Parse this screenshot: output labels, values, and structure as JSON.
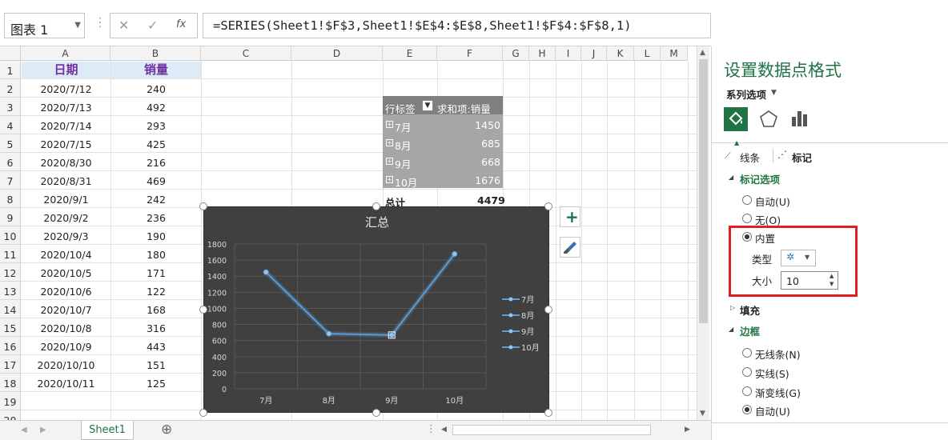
{
  "name_box": {
    "value": "图表 1"
  },
  "formula_bar": {
    "cancel_icon": "✕",
    "enter_icon": "✓",
    "fx_icon": "fx",
    "formula": "=SERIES(Sheet1!$F$3,Sheet1!$E$4:$E$8,Sheet1!$F$4:$F$8,1)"
  },
  "grid": {
    "columns": [
      "A",
      "B",
      "C",
      "D",
      "E",
      "F",
      "G",
      "H",
      "I",
      "J",
      "K",
      "L",
      "M"
    ],
    "rows": [
      "1",
      "2",
      "3",
      "4",
      "5",
      "6",
      "7",
      "8",
      "9",
      "10",
      "11",
      "12",
      "13",
      "14",
      "15",
      "16",
      "17",
      "18",
      "19",
      "20"
    ],
    "header_date": "日期",
    "header_sales": "销量",
    "dates": [
      "2020/7/12",
      "2020/7/13",
      "2020/7/14",
      "2020/7/15",
      "2020/8/30",
      "2020/8/31",
      "2020/9/1",
      "2020/9/2",
      "2020/9/3",
      "2020/10/4",
      "2020/10/5",
      "2020/10/6",
      "2020/10/7",
      "2020/10/8",
      "2020/10/9",
      "2020/10/10",
      "2020/10/11"
    ],
    "sales": [
      "240",
      "492",
      "293",
      "425",
      "216",
      "469",
      "242",
      "236",
      "190",
      "180",
      "171",
      "122",
      "168",
      "316",
      "443",
      "151",
      "125"
    ]
  },
  "pivot": {
    "row_label": "行标签",
    "sum_label": "求和项:销量",
    "rows": [
      {
        "label": "7月",
        "value": "1450"
      },
      {
        "label": "8月",
        "value": "685"
      },
      {
        "label": "9月",
        "value": "668"
      },
      {
        "label": "10月",
        "value": "1676"
      }
    ],
    "total_label": "总计",
    "total_value": "4479"
  },
  "chart_data": {
    "type": "line",
    "title": "汇总",
    "categories": [
      "7月",
      "8月",
      "9月",
      "10月"
    ],
    "series": [
      {
        "values": [
          1450,
          685,
          668,
          1676
        ]
      }
    ],
    "ylim": [
      0,
      1800
    ],
    "yticks": [
      "0",
      "200",
      "400",
      "600",
      "800",
      "1000",
      "1200",
      "1400",
      "1600",
      "1800"
    ],
    "legend": [
      "7月",
      "8月",
      "9月",
      "10月"
    ],
    "legend_position": "right",
    "grid": true,
    "selected_point": "9月",
    "line_color": "#5b9bd5",
    "background": "#404040"
  },
  "chart_buttons": {
    "add_icon": "+",
    "brush_icon": "brush"
  },
  "sheet_tabs": {
    "active": "Sheet1",
    "add_icon": "⊕"
  },
  "panel": {
    "title": "设置数据点格式",
    "series_options": "系列选项",
    "tab_line": "线条",
    "tab_marker": "标记",
    "marker_options": "标记选项",
    "auto": "自动(U)",
    "none": "无(O)",
    "builtin": "内置",
    "type_label": "类型",
    "size_label": "大小",
    "size_value": "10",
    "fill": "填充",
    "border": "边框",
    "no_line": "无线条(N)",
    "solid_line": "实线(S)",
    "gradient_line": "渐变线(G)",
    "auto_border": "自动(U)"
  },
  "colors": {
    "accent": "#217346",
    "header_fill": "#ddebf7",
    "header_text": "#7030a0",
    "highlight": "#e31e24"
  }
}
